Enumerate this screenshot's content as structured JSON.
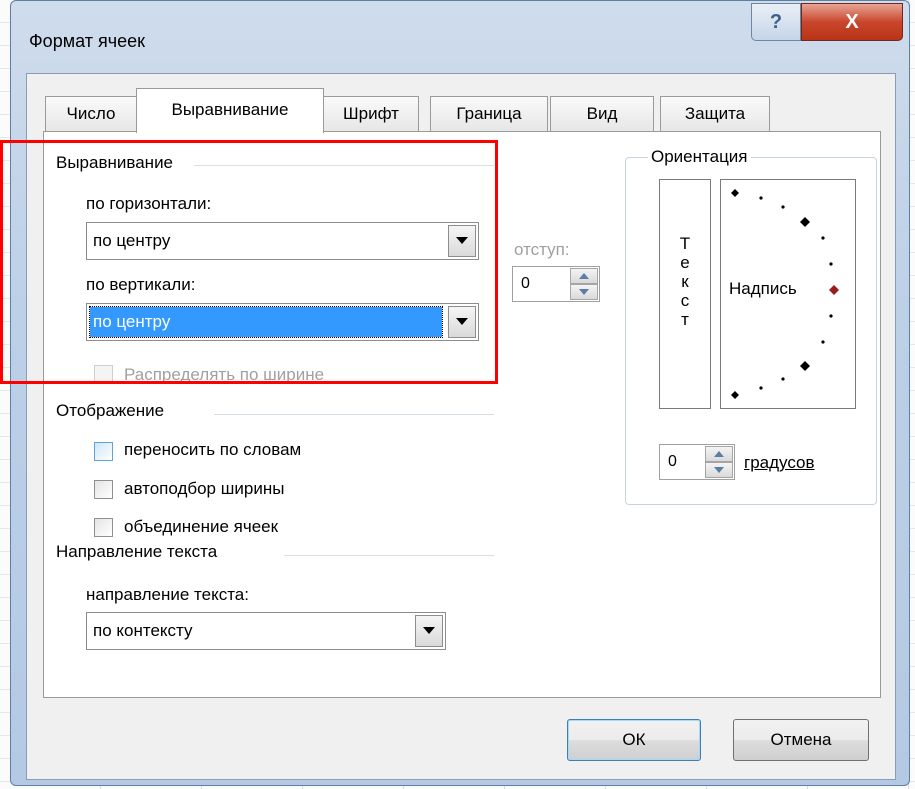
{
  "dialog": {
    "title": "Формат ячеек",
    "help_glyph": "?",
    "close_glyph": "X"
  },
  "tabs": [
    {
      "label": "Число",
      "active": false
    },
    {
      "label": "Выравнивание",
      "active": true
    },
    {
      "label": "Шрифт",
      "active": false
    },
    {
      "label": "Граница",
      "active": false
    },
    {
      "label": "Вид",
      "active": false
    },
    {
      "label": "Защита",
      "active": false
    }
  ],
  "alignment": {
    "group_title": "Выравнивание",
    "horizontal_label": "по горизонтали:",
    "horizontal_value": "по центру",
    "indent_label": "отступ:",
    "indent_value": "0",
    "vertical_label": "по вертикали:",
    "vertical_value": "по центру",
    "distribute_label": "Распределять по ширине",
    "distribute_checked": false
  },
  "display": {
    "group_title": "Отображение",
    "wrap_label": "переносить по словам",
    "shrink_label": "автоподбор ширины",
    "merge_label": "объединение ячеек"
  },
  "text_direction": {
    "group_title": "Направление текста",
    "label": "направление текста:",
    "value": "по контексту"
  },
  "orientation": {
    "group_title": "Ориентация",
    "vertical_text": [
      "Т",
      "е",
      "к",
      "с",
      "т"
    ],
    "dial_label": "Надпись",
    "degrees_value": "0",
    "degrees_label": "градусов"
  },
  "buttons": {
    "ok": "ОК",
    "cancel": "Отмена"
  },
  "annotation_color": "#ff0000"
}
